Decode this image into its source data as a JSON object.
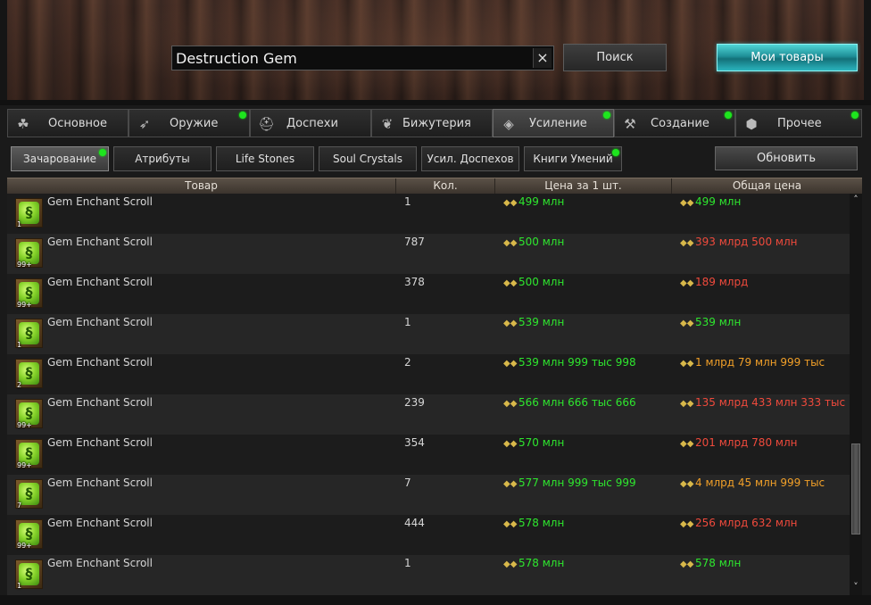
{
  "search": {
    "value": "Destruction Gem",
    "clear_icon": "×",
    "button_label": "Поиск"
  },
  "my_goods_label": "Мои товары",
  "categories": [
    {
      "label": "Основное",
      "icon": "☘",
      "dot": false,
      "active": false
    },
    {
      "label": "Оружие",
      "icon": "➶",
      "dot": true,
      "active": false
    },
    {
      "label": "Доспехи",
      "icon": "⛑",
      "dot": false,
      "active": false
    },
    {
      "label": "Бижутерия",
      "icon": "❦",
      "dot": false,
      "active": false
    },
    {
      "label": "Усиление",
      "icon": "◈",
      "dot": true,
      "active": true
    },
    {
      "label": "Создание",
      "icon": "⚒",
      "dot": true,
      "active": false
    },
    {
      "label": "Прочее",
      "icon": "⬢",
      "dot": true,
      "active": false
    }
  ],
  "subcategories": [
    {
      "label": "Зачарование",
      "dot": true,
      "active": true
    },
    {
      "label": "Атрибуты",
      "dot": false,
      "active": false
    },
    {
      "label": "Life Stones",
      "dot": false,
      "active": false
    },
    {
      "label": "Soul Crystals",
      "dot": false,
      "active": false
    },
    {
      "label": "Усил. Доспехов",
      "dot": false,
      "active": false
    },
    {
      "label": "Книги Умений",
      "dot": true,
      "active": false
    }
  ],
  "refresh_label": "Обновить",
  "table": {
    "headers": [
      "Товар",
      "Кол.",
      "Цена за 1 шт.",
      "Общая цена"
    ],
    "rows": [
      {
        "item": "Gem Enchant Scroll",
        "badge": "1",
        "qty": "1",
        "unit_price": "499 млн",
        "unit_color": "green",
        "total_price": "499 млн",
        "total_color": "green"
      },
      {
        "item": "Gem Enchant Scroll",
        "badge": "99+",
        "qty": "787",
        "unit_price": "500 млн",
        "unit_color": "green",
        "total_price": "393 млрд 500 млн",
        "total_color": "red"
      },
      {
        "item": "Gem Enchant Scroll",
        "badge": "99+",
        "qty": "378",
        "unit_price": "500 млн",
        "unit_color": "green",
        "total_price": "189 млрд",
        "total_color": "red"
      },
      {
        "item": "Gem Enchant Scroll",
        "badge": "1",
        "qty": "1",
        "unit_price": "539 млн",
        "unit_color": "green",
        "total_price": "539 млн",
        "total_color": "green"
      },
      {
        "item": "Gem Enchant Scroll",
        "badge": "2",
        "qty": "2",
        "unit_price": "539 млн 999 тыс 998",
        "unit_color": "green",
        "total_price": "1 млрд 79 млн 999 тыс",
        "total_color": "orange"
      },
      {
        "item": "Gem Enchant Scroll",
        "badge": "99+",
        "qty": "239",
        "unit_price": "566 млн 666 тыс 666",
        "unit_color": "green",
        "total_price": "135 млрд 433 млн 333 тыс",
        "total_color": "red"
      },
      {
        "item": "Gem Enchant Scroll",
        "badge": "99+",
        "qty": "354",
        "unit_price": "570 млн",
        "unit_color": "green",
        "total_price": "201 млрд 780 млн",
        "total_color": "red"
      },
      {
        "item": "Gem Enchant Scroll",
        "badge": "7",
        "qty": "7",
        "unit_price": "577 млн 999 тыс 999",
        "unit_color": "green",
        "total_price": "4 млрд 45 млн 999 тыс",
        "total_color": "orange"
      },
      {
        "item": "Gem Enchant Scroll",
        "badge": "99+",
        "qty": "444",
        "unit_price": "578 млн",
        "unit_color": "green",
        "total_price": "256 млрд 632 млн",
        "total_color": "red"
      },
      {
        "item": "Gem Enchant Scroll",
        "badge": "1",
        "qty": "1",
        "unit_price": "578 млн",
        "unit_color": "green",
        "total_price": "578 млн",
        "total_color": "green"
      }
    ]
  },
  "scroll": {
    "up": "˄",
    "down": "˅",
    "position": 0.83
  }
}
